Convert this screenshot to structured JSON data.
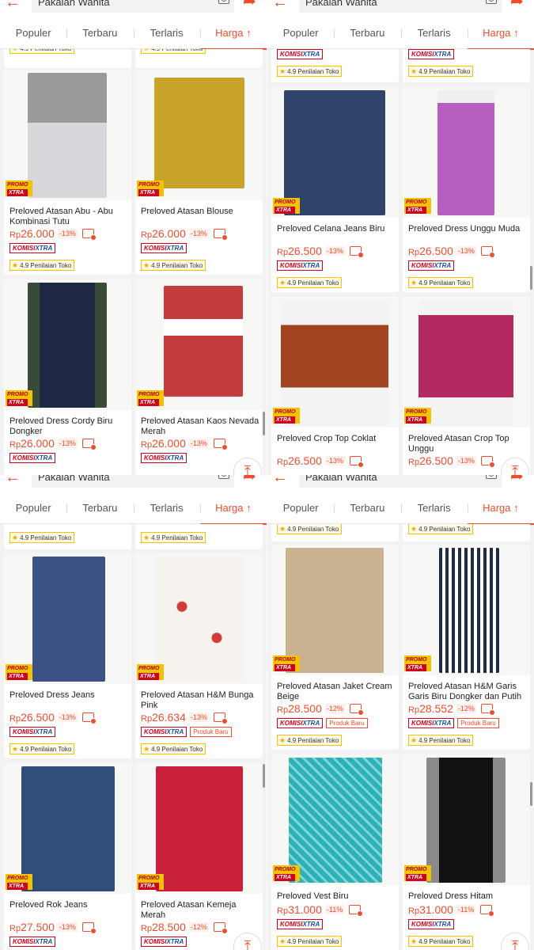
{
  "search": {
    "query": "Pakaian Wanita"
  },
  "tabs": [
    "Populer",
    "Terbaru",
    "Terlaris",
    "Harga ↑"
  ],
  "labels": {
    "rating": "4.9 Penilaian Toko",
    "komisi_a": "KOMISI",
    "komisi_b": "XTRA",
    "promo_a": "PROMO",
    "promo_b": "XTRA",
    "new": "Produk Baru",
    "currency": "Rp"
  },
  "colors": {
    "accent": "#ee4d2d",
    "promo_yellow": "#f6c200",
    "brand_red": "#d0011b"
  },
  "quadrants": [
    {
      "products": [
        {
          "title": "Preloved Atasan Abu - Abu Kombinasi Tutu",
          "price": "26.000",
          "discount": "-13%"
        },
        {
          "title": "Preloved Atasan Blouse",
          "price": "26.000",
          "discount": "-13%"
        },
        {
          "title": "Preloved Dress Cordy Biru Dongker",
          "price": "26.000",
          "discount": "-13%"
        },
        {
          "title": "Preloved Atasan Kaos Nevada Merah",
          "price": "26.000",
          "discount": "-13%"
        }
      ]
    },
    {
      "products": [
        {
          "title": "Preloved Celana Jeans Biru",
          "price": "26.500",
          "discount": "-13%"
        },
        {
          "title": "Preloved Dress Unggu Muda",
          "price": "26.500",
          "discount": "-13%"
        },
        {
          "title": "Preloved Crop Top Coklat",
          "price": "26.500",
          "discount": "-13%"
        },
        {
          "title": "Preloved Atasan Crop Top Unggu",
          "price": "26.500",
          "discount": "-13%"
        }
      ]
    },
    {
      "products": [
        {
          "title": "Preloved Dress Jeans",
          "price": "26.500",
          "discount": "-13%"
        },
        {
          "title": "Preloved Atasan H&M Bunga Pink",
          "price": "26.634",
          "discount": "-13%"
        },
        {
          "title": "Preloved Rok Jeans",
          "price": "27.500",
          "discount": "-13%"
        },
        {
          "title": "Preloved Atasan Kemeja Merah",
          "price": "28.500",
          "discount": "-12%"
        }
      ]
    },
    {
      "products": [
        {
          "title": "Preloved Atasan Jaket  Cream Beige",
          "price": "28.500",
          "discount": "-12%"
        },
        {
          "title": "Preloved Atasan H&M Garis Garis Biru Dongker dan Putih",
          "price": "28.552",
          "discount": "-12%"
        },
        {
          "title": "Preloved Vest Biru",
          "price": "31.000",
          "discount": "-11%"
        },
        {
          "title": "Preloved Dress Hitam",
          "price": "31.000",
          "discount": "-11%"
        }
      ]
    }
  ]
}
